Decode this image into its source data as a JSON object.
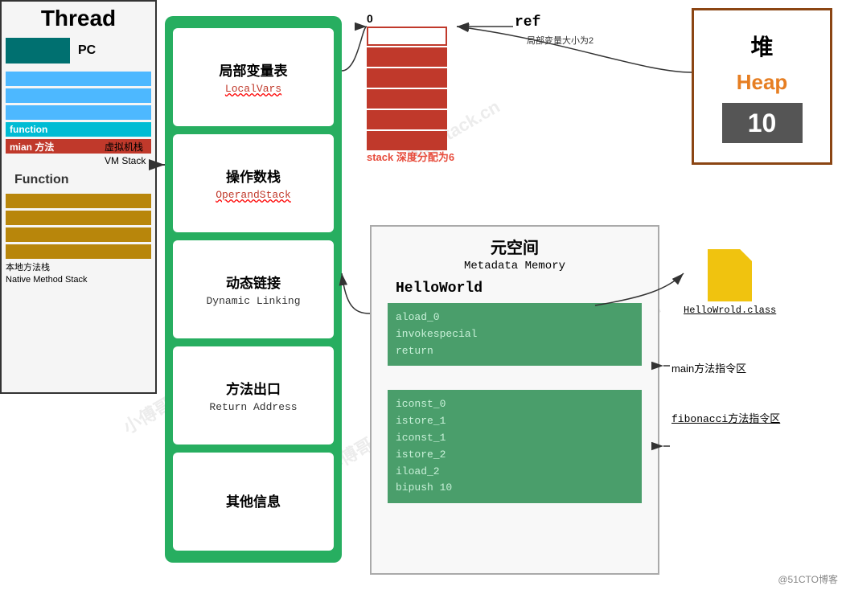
{
  "thread": {
    "title": "Thread",
    "pc_label": "PC",
    "vm_stack_zh": "虚拟机栈",
    "vm_stack_en": "VM Stack",
    "function_label": "Function",
    "function_bar": "function",
    "mian_bar": "mian 方法",
    "native_zh": "本地方法栈",
    "native_en": "Native Method Stack"
  },
  "vm_frame": {
    "local_vars_zh": "局部变量表",
    "local_vars_en": "LocalVars",
    "operand_zh": "操作数栈",
    "operand_en": "OperandStack",
    "dynamic_zh": "动态链接",
    "dynamic_en": "Dynamic Linking",
    "return_zh": "方法出口",
    "return_en": "Return Address",
    "other_zh": "其他信息"
  },
  "stack": {
    "index_label": "0",
    "ref_label": "ref",
    "depth_label": "stack 深度分配为6",
    "local_size_label": "局部变量大小为2"
  },
  "heap": {
    "title_zh": "堆",
    "title_en": "Heap",
    "value": "10"
  },
  "metadata": {
    "title_zh": "元空间",
    "title_en": "Metadata Memory",
    "hello_world": "HelloWorld",
    "code_block1_lines": [
      "aload_0",
      "invokespecial",
      "return"
    ],
    "code_block2_lines": [
      "iconst_0",
      "istore_1",
      "iconst_1",
      "istore_2",
      "iload_2",
      "bipush 10"
    ]
  },
  "class_file": {
    "name": "HelloWrold.class"
  },
  "labels": {
    "main_method": "main方法指令区",
    "fib_method": "fibonacci方法指令区",
    "credit": "@51CTO博客"
  }
}
